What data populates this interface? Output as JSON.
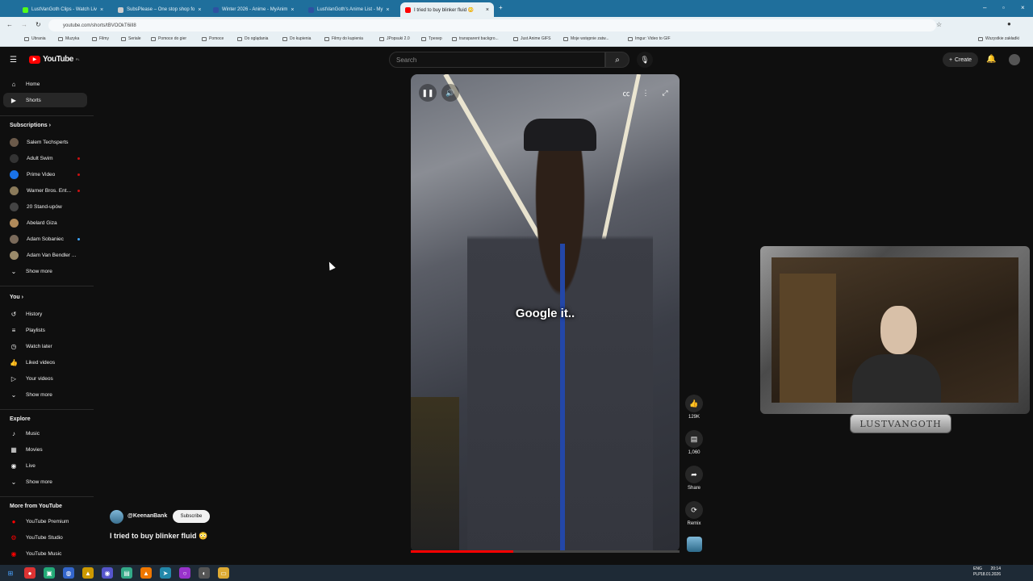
{
  "browser": {
    "tabs": [
      {
        "label": "LustVanGoth Clips - Watch Liv",
        "color": "#53fc18"
      },
      {
        "label": "SubsPlease – One stop shop fo",
        "color": "#cccccc"
      },
      {
        "label": "Winter 2026 - Anime - MyAnim",
        "color": "#2e51a2"
      },
      {
        "label": "LustVanGoth's Anime List - My",
        "color": "#2e51a2"
      },
      {
        "label": "I tried to buy blinker fluid 😳",
        "color": "#ff0000"
      }
    ],
    "url": "youtube.com/shorts/tBVOOkT6ilI8",
    "bookmarks": [
      "Ubrania",
      "Muzyka",
      "Filmy",
      "Seriale",
      "Pomoce do gier",
      "Pomoce",
      "Do oglądania",
      "Do kupienia",
      "Filmy do kupienia",
      "JPopsuki 2.0",
      "Tpexep",
      "transparent backgro...",
      "Just Anime GIFS",
      "Moje wstępnie zatw...",
      "Imgur: Video to GIF"
    ],
    "bookmarks_right": "Wszystkie zakładki"
  },
  "yt": {
    "logo": "YouTube",
    "logo_region": "PL",
    "search_placeholder": "Search",
    "create_label": "Create"
  },
  "sidebar": {
    "main": [
      {
        "label": "Home",
        "icon": "home-icon"
      },
      {
        "label": "Shorts",
        "icon": "shorts-icon"
      }
    ],
    "subscriptions_header": "Subscriptions",
    "subscriptions": [
      {
        "label": "Salem Techsperts",
        "color": "#6b5a4a"
      },
      {
        "label": "Adult Swim",
        "color": "#333333"
      },
      {
        "label": "Prime Video",
        "color": "#1a73e8"
      },
      {
        "label": "Warner Bros. Ent...",
        "color": "#8a7a5a"
      },
      {
        "label": "20 Stand-upów",
        "color": "#444444"
      },
      {
        "label": "Abelard Giza",
        "color": "#b08a5a"
      },
      {
        "label": "Adam Sobaniec",
        "color": "#7a6a5a"
      },
      {
        "label": "Adam Van Bendler ...",
        "color": "#9a8a6a"
      }
    ],
    "subs_show_more": "Show more",
    "you_header": "You",
    "you": [
      {
        "label": "History",
        "icon": "history-icon"
      },
      {
        "label": "Playlists",
        "icon": "playlists-icon"
      },
      {
        "label": "Watch later",
        "icon": "watch-later-icon"
      },
      {
        "label": "Liked videos",
        "icon": "liked-icon"
      },
      {
        "label": "Your videos",
        "icon": "your-videos-icon"
      }
    ],
    "you_show_more": "Show more",
    "explore_header": "Explore",
    "explore": [
      {
        "label": "Music",
        "icon": "music-icon"
      },
      {
        "label": "Movies",
        "icon": "movies-icon"
      },
      {
        "label": "Live",
        "icon": "live-icon"
      }
    ],
    "explore_show_more": "Show more",
    "more_header": "More from YouTube",
    "more": [
      {
        "label": "YouTube Premium"
      },
      {
        "label": "YouTube Studio"
      },
      {
        "label": "YouTube Music"
      }
    ]
  },
  "video": {
    "caption": "Google it..",
    "progress": 0.38,
    "channel": "@KeenanBank",
    "subscribe": "Subscribe",
    "title": "I tried to buy blinker fluid 😳"
  },
  "actions": {
    "likes": "129K",
    "comments": "1,060",
    "share": "Share",
    "remix": "Remix"
  },
  "webcam": {
    "label": "LUSTVANGOTH"
  },
  "taskbar": {
    "lang1": "ENG",
    "lang2": "PLP",
    "time": "20:14",
    "date": "18.01.2026"
  }
}
